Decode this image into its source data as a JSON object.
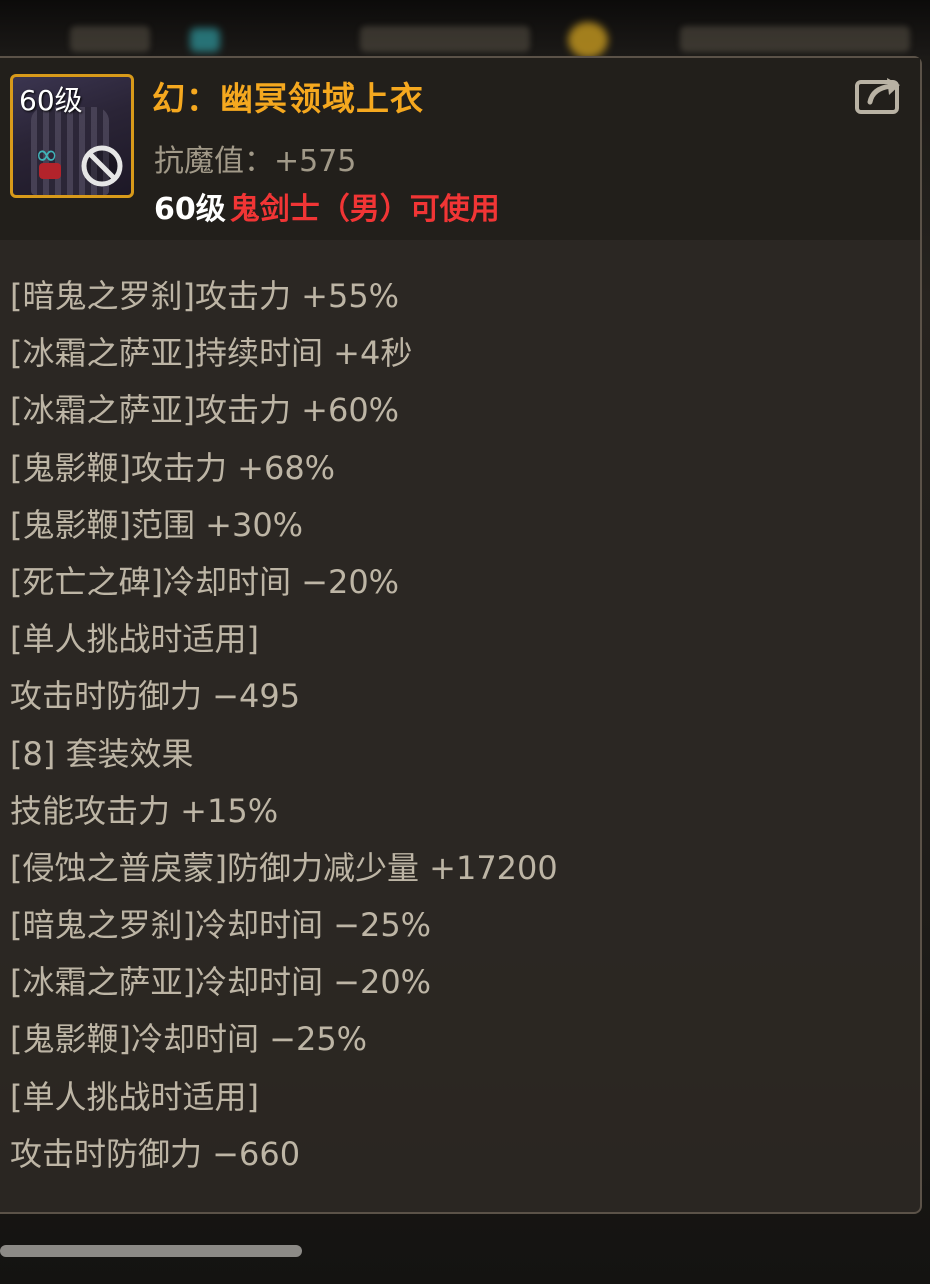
{
  "item": {
    "level_badge": "60级",
    "name": "幻：幽冥领域上衣",
    "stat": "抗魔值：+575",
    "requirement_level": "60级",
    "requirement_class": "鬼剑士（男）可使用"
  },
  "icons": {
    "share": "share-icon",
    "unusable": "no-entry-icon"
  },
  "colors": {
    "item_name": "#f5a81f",
    "requirement_class": "#f13535",
    "icon_border": "#d89a1a",
    "effect_text": "#bdb5a5"
  },
  "effects": [
    "[暗鬼之罗刹]攻击力 +55%",
    "[冰霜之萨亚]持续时间 +4秒",
    "[冰霜之萨亚]攻击力 +60%",
    "[鬼影鞭]攻击力 +68%",
    "[鬼影鞭]范围 +30%",
    "[死亡之碑]冷却时间 −20%",
    "[单人挑战时适用]",
    "攻击时防御力 −495",
    "[8] 套装效果",
    "技能攻击力 +15%",
    "[侵蚀之普戾蒙]防御力减少量 +17200",
    "[暗鬼之罗刹]冷却时间 −25%",
    "[冰霜之萨亚]冷却时间 −20%",
    "[鬼影鞭]冷却时间 −25%",
    "[单人挑战时适用]",
    "攻击时防御力 −660"
  ]
}
